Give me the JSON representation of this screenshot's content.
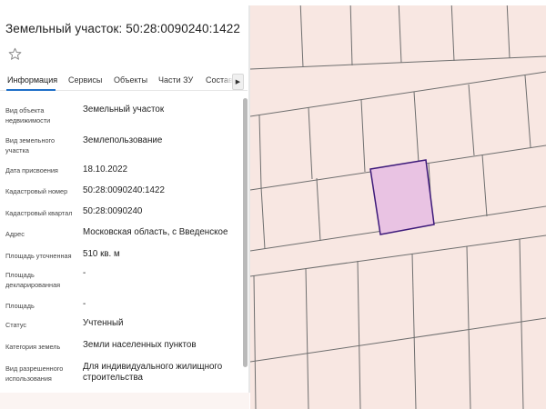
{
  "panel": {
    "title": "Земельный участок: 50:28:0090240:1422",
    "tabs": [
      {
        "label": "Информация",
        "active": true
      },
      {
        "label": "Сервисы",
        "active": false
      },
      {
        "label": "Объекты",
        "active": false
      },
      {
        "label": "Части ЗУ",
        "active": false
      },
      {
        "label": "Состав",
        "active": false
      }
    ],
    "properties": [
      {
        "label": "Вид объекта недвижимости",
        "value": "Земельный участок"
      },
      {
        "label": "Вид земельного участка",
        "value": "Землепользование"
      },
      {
        "label": "Дата присвоения",
        "value": "18.10.2022"
      },
      {
        "label": "Кадастровый номер",
        "value": "50:28:0090240:1422"
      },
      {
        "label": "Кадастровый квартал",
        "value": "50:28:0090240"
      },
      {
        "label": "Адрес",
        "value": "Московская область, с Введенское"
      },
      {
        "label": "Площадь уточненная",
        "value": "510 кв. м"
      },
      {
        "label": "Площадь декларированная",
        "value": "-"
      },
      {
        "label": "Площадь",
        "value": "-"
      },
      {
        "label": "Статус",
        "value": "Учтенный"
      },
      {
        "label": "Категория земель",
        "value": "Земли населенных пунктов"
      },
      {
        "label": "Вид разрешенного использования",
        "value": "Для индивидуального жилищного строительства"
      }
    ]
  },
  "icons": {
    "favorite": "star-outline-icon",
    "tabs_next": "chevron-right-icon"
  },
  "colors": {
    "map_background": "#f8e7e2",
    "parcel_lines": "#6e6e6e",
    "selected_parcel_fill": "#e9c3e3",
    "selected_parcel_stroke": "#3d1a7a",
    "active_tab_underline": "#1e6fc8"
  }
}
